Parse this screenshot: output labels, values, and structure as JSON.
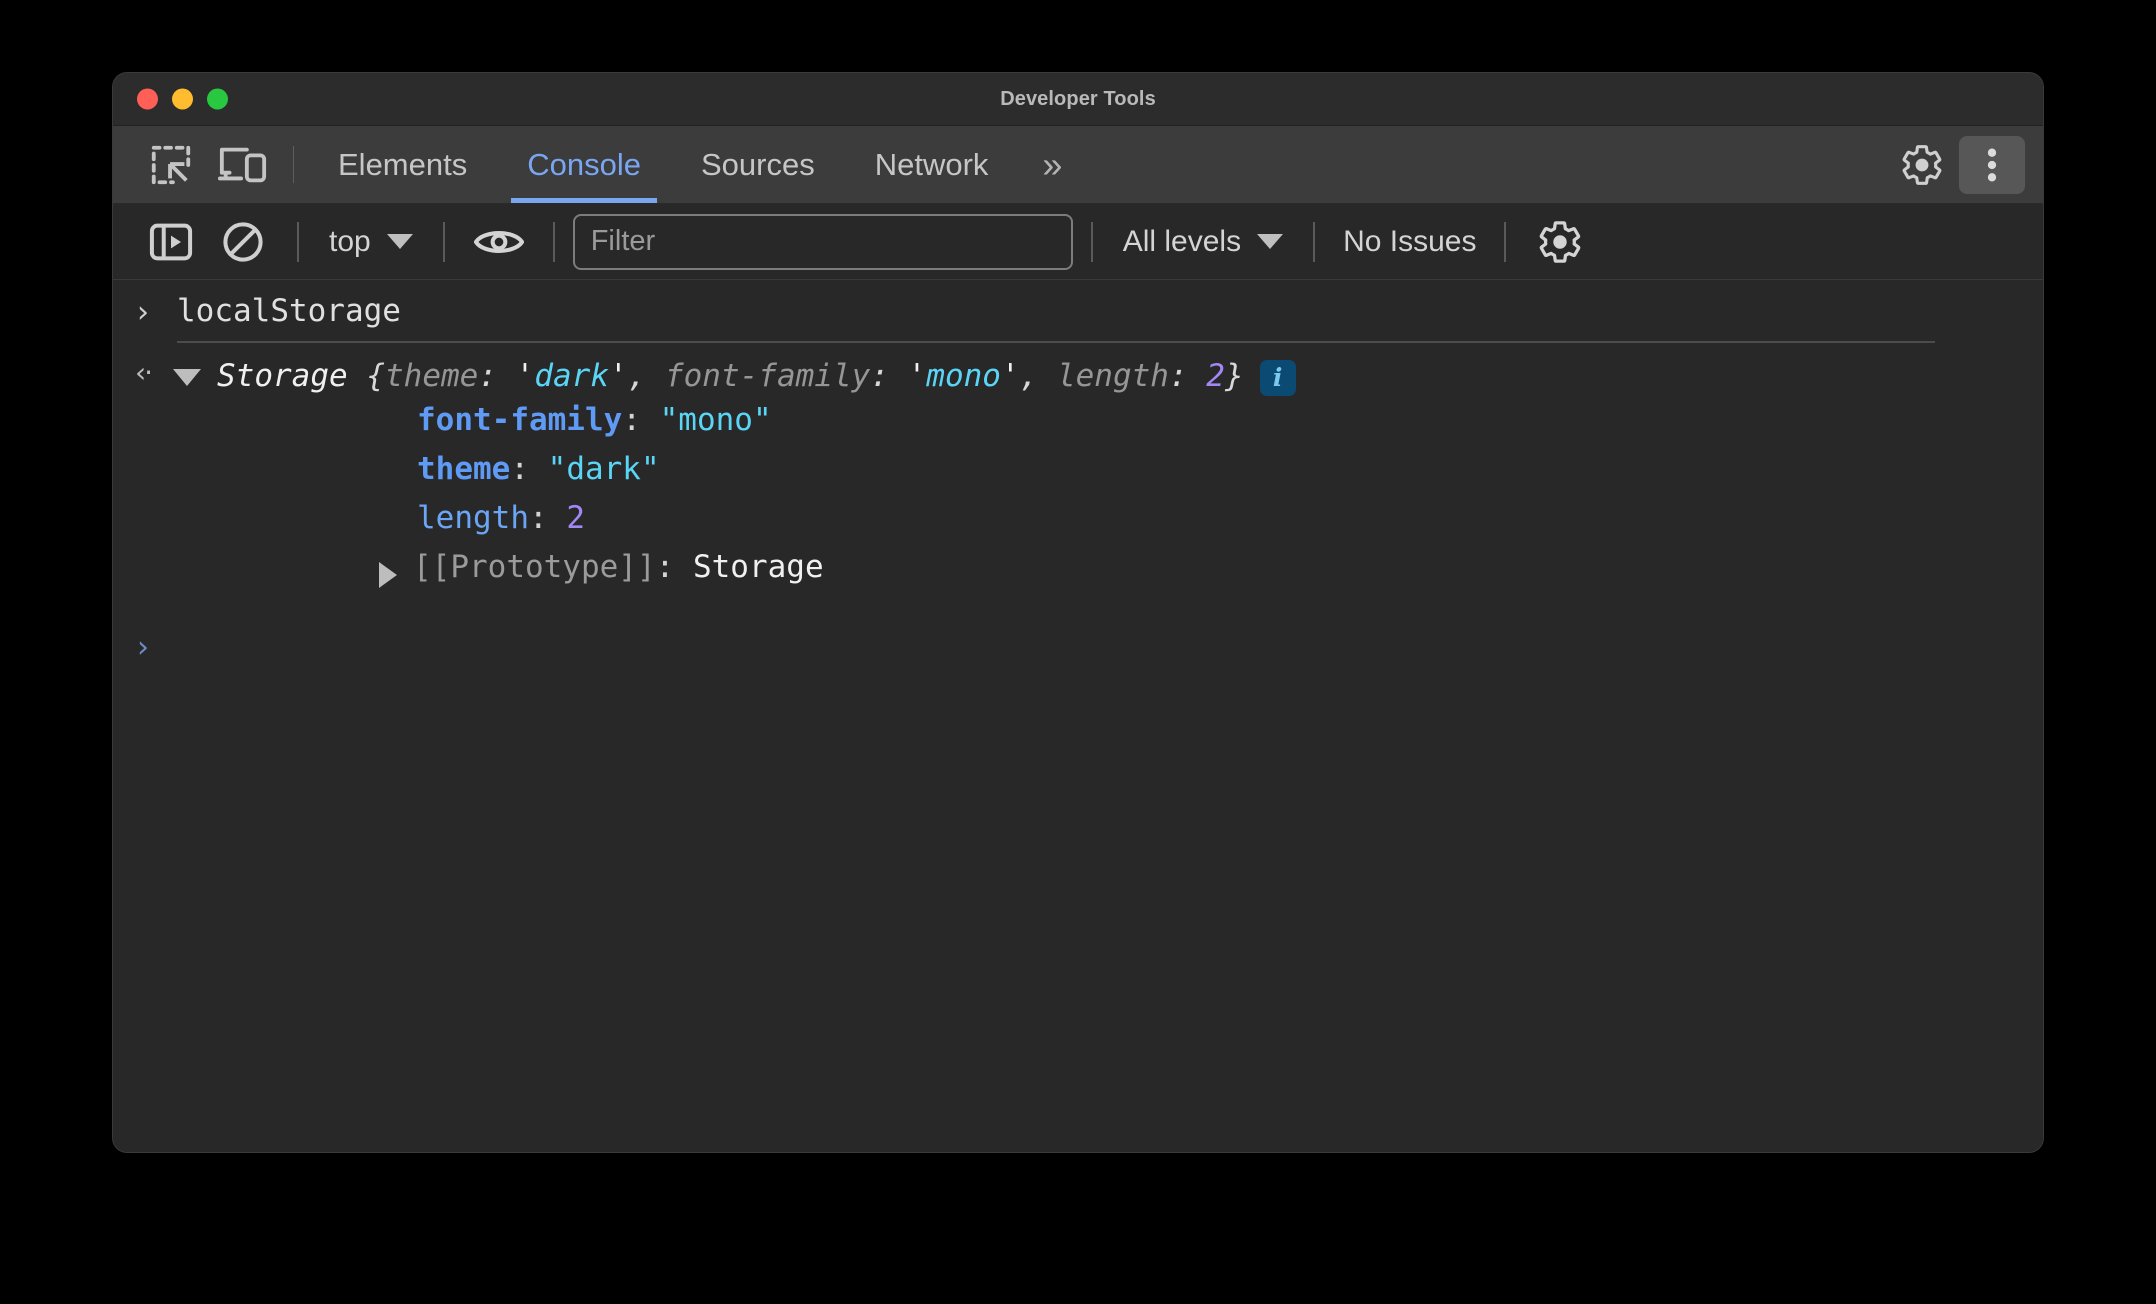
{
  "window": {
    "title": "Developer Tools",
    "traffic_lights": [
      "close",
      "minimize",
      "maximize"
    ]
  },
  "tabbar": {
    "inspect_icon": "inspect-element-icon",
    "device_icon": "device-toolbar-icon",
    "tabs": [
      {
        "label": "Elements",
        "active": false
      },
      {
        "label": "Console",
        "active": true
      },
      {
        "label": "Sources",
        "active": false
      },
      {
        "label": "Network",
        "active": false
      }
    ],
    "more_tabs_label": "»",
    "settings_icon": "gear-icon",
    "menu_icon": "kebab-menu-icon",
    "active_tab_color": "#7aa6f0"
  },
  "console_toolbar": {
    "sidebar_toggle_icon": "console-sidebar-icon",
    "clear_icon": "clear-console-icon",
    "context_label": "top",
    "eye_icon": "live-expression-eye-icon",
    "filter": {
      "value": "",
      "placeholder": "Filter"
    },
    "levels_label": "All levels",
    "issues_label": "No Issues",
    "settings_icon": "gear-icon"
  },
  "console": {
    "input": {
      "prompt": "›",
      "expression": "localStorage"
    },
    "result": {
      "arrow": "‹·",
      "expanded": true,
      "class_name": "Storage",
      "open_brace": "{",
      "close_brace": "}",
      "preview_entries": [
        {
          "key": "theme",
          "quote": "'",
          "value": "dark",
          "type": "string",
          "separator": ", "
        },
        {
          "key": "font-family",
          "quote": "'",
          "value": "mono",
          "type": "string",
          "separator": ", "
        },
        {
          "key": "length",
          "quote": "",
          "value": "2",
          "type": "number",
          "separator": ""
        }
      ],
      "info_badge": "i",
      "properties": [
        {
          "name": "font-family",
          "value": "\"mono\"",
          "kind": "own",
          "value_type": "string"
        },
        {
          "name": "theme",
          "value": "\"dark\"",
          "kind": "own",
          "value_type": "string"
        },
        {
          "name": "length",
          "value": "2",
          "kind": "native",
          "value_type": "number"
        },
        {
          "name": "[[Prototype]]",
          "value": "Storage",
          "kind": "proto",
          "value_type": "object"
        }
      ]
    },
    "bottom_prompt": "›"
  },
  "colors": {
    "accent": "#7aa6f0",
    "string": "#5bd5f5",
    "number": "#a387f5",
    "property": "#6ba5f5",
    "background": "#282828",
    "tabbar": "#3c3c3c",
    "titlebar": "#2c2c2c"
  }
}
